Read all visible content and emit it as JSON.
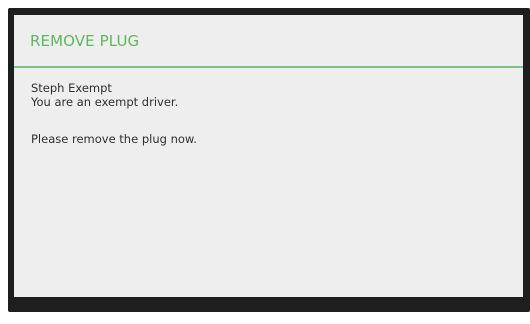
{
  "dialog": {
    "title": "REMOVE PLUG",
    "driver_name": "Steph Exempt",
    "driver_status": "You are an exempt driver.",
    "instruction": "Please remove the plug now."
  },
  "colors": {
    "accent": "#5cb85c",
    "divider": "#7fc37f",
    "bezel": "#1e1e1e",
    "screen_background": "#eeeeee"
  }
}
